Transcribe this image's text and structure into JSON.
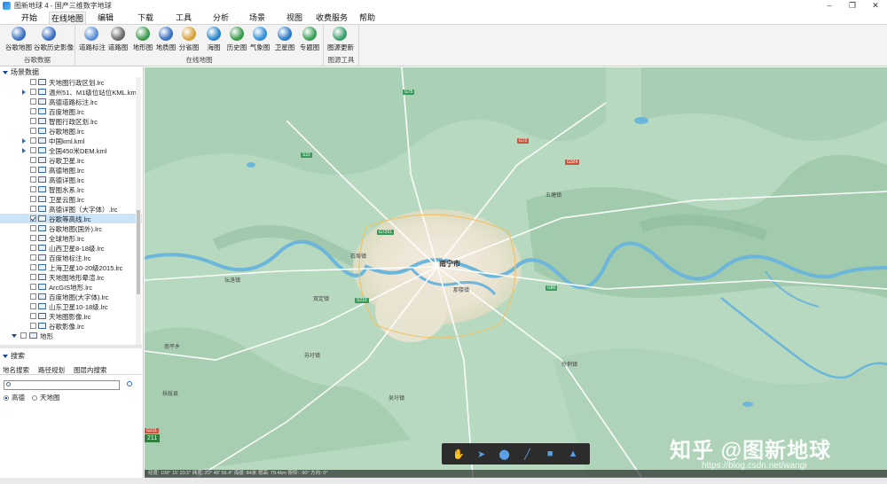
{
  "window": {
    "title": "图新地球 4 - 国产三维数字地球"
  },
  "menu": [
    {
      "label": "开始",
      "active": false
    },
    {
      "label": "在线地图",
      "active": true
    },
    {
      "label": "编辑",
      "active": false
    },
    {
      "label": "下载",
      "active": false
    },
    {
      "label": "工具",
      "active": false
    },
    {
      "label": "分析",
      "active": false
    },
    {
      "label": "场景",
      "active": false
    },
    {
      "label": "视图",
      "active": false
    },
    {
      "label": "收费服务",
      "active": false
    },
    {
      "label": "帮助",
      "active": false
    }
  ],
  "ribbon": {
    "groups": [
      {
        "label": "谷歌数据",
        "buttons": [
          {
            "label": "谷歌地图",
            "icon": "globe-icon",
            "color": "#3b6fc2"
          },
          {
            "label": "谷歌历史影像",
            "icon": "history-globe-icon",
            "color": "#3b6fc2"
          }
        ]
      },
      {
        "label": "在线地图",
        "buttons": [
          {
            "label": "道路标注",
            "icon": "road-label-icon",
            "color": "#5a8fd6"
          },
          {
            "label": "道路图",
            "icon": "road-map-icon",
            "color": "#6a6a6a"
          },
          {
            "label": "地形图",
            "icon": "terrain-icon",
            "color": "#3f9a52"
          },
          {
            "label": "地质图",
            "icon": "geology-icon",
            "color": "#3a72c0"
          },
          {
            "label": "分省图",
            "icon": "province-icon",
            "color": "#d8a23a"
          },
          {
            "label": "海图",
            "icon": "sea-chart-icon",
            "color": "#2a86c9"
          },
          {
            "label": "历史图",
            "icon": "history-map-icon",
            "color": "#3b9a4b"
          },
          {
            "label": "气象图",
            "icon": "weather-icon",
            "color": "#2f8fd8"
          },
          {
            "label": "卫星图",
            "icon": "satellite-icon",
            "color": "#2d7ac9"
          },
          {
            "label": "专题图",
            "icon": "thematic-icon",
            "color": "#3aa055"
          }
        ]
      },
      {
        "label": "图源工具",
        "buttons": [
          {
            "label": "图源更新",
            "icon": "source-update-icon",
            "color": "#3aa06a"
          }
        ]
      }
    ]
  },
  "panel": {
    "title": "场景数据",
    "layers": [
      {
        "label": "天地图行政区划.lrc",
        "checked": false,
        "expander": "none"
      },
      {
        "label": "温州51、M1级位站位KML.kml",
        "checked": false,
        "expander": "closed"
      },
      {
        "label": "高德道路标注.lrc",
        "checked": false,
        "expander": "none"
      },
      {
        "label": "百度地图.lrc",
        "checked": false,
        "expander": "none"
      },
      {
        "label": "智图行政区划.lrc",
        "checked": false,
        "expander": "none"
      },
      {
        "label": "谷歌地图.lrc",
        "checked": false,
        "expander": "none"
      },
      {
        "label": "中国kml.kml",
        "checked": false,
        "expander": "closed"
      },
      {
        "label": "全国450米DEM.kml",
        "checked": false,
        "expander": "closed"
      },
      {
        "label": "谷歌卫星.lrc",
        "checked": false,
        "expander": "none"
      },
      {
        "label": "高德地图.lrc",
        "checked": false,
        "expander": "none"
      },
      {
        "label": "高德详图.lrc",
        "checked": false,
        "expander": "none"
      },
      {
        "label": "智图水系.lrc",
        "checked": false,
        "expander": "none"
      },
      {
        "label": "卫星云图.lrc",
        "checked": false,
        "expander": "none"
      },
      {
        "label": "高德详图（大字体）.lrc",
        "checked": false,
        "expander": "none"
      },
      {
        "label": "谷歌等高线.lrc",
        "checked": true,
        "expander": "none",
        "selected": true
      },
      {
        "label": "谷歌地图(国外).lrc",
        "checked": false,
        "expander": "none"
      },
      {
        "label": "全球地形.lrc",
        "checked": false,
        "expander": "none"
      },
      {
        "label": "山西卫星8-18级.lrc",
        "checked": false,
        "expander": "none"
      },
      {
        "label": "百度地标注.lrc",
        "checked": false,
        "expander": "none"
      },
      {
        "label": "上海卫星10-20级2015.lrc",
        "checked": false,
        "expander": "none"
      },
      {
        "label": "天地图地形晕渲.lrc",
        "checked": false,
        "expander": "none"
      },
      {
        "label": "ArcGIS地形.lrc",
        "checked": false,
        "expander": "none"
      },
      {
        "label": "百度地图(大字体).lrc",
        "checked": false,
        "expander": "none"
      },
      {
        "label": "山东卫星10-18级.lrc",
        "checked": false,
        "expander": "none"
      },
      {
        "label": "天地图影像.lrc",
        "checked": false,
        "expander": "none"
      },
      {
        "label": "谷歌影像.lrc",
        "checked": false,
        "expander": "none"
      }
    ],
    "terrain_node": "地形"
  },
  "search": {
    "title": "搜索",
    "tabs": [
      "地名搜索",
      "路径规划",
      "图层内搜索"
    ],
    "input_value": "",
    "sources": [
      {
        "label": "高德",
        "selected": true
      },
      {
        "label": "天地图",
        "selected": false
      }
    ]
  },
  "map": {
    "city": "南宁市",
    "places": [
      "南平乡",
      "扶绥县",
      "五塘镇",
      "那楼镇",
      "伶俐镇",
      "双定镇",
      "吴圩镇",
      "苏圩镇",
      "坛洛镇",
      "石埠镇"
    ],
    "shields": [
      "G75",
      "G72",
      "S22",
      "G7201",
      "G324",
      "G80",
      "S210",
      "G211"
    ],
    "road_badge": "211",
    "watermark": "知乎 @图新地球",
    "blogmark": "https://blog.csdn.net/wangi",
    "status": "经度: 108° 15' 20.5\"  纬度: 22° 48' 56.4\"  海拔: 84米  视高: 79.4km  俯仰: -90°  方向: 0°"
  },
  "toolbar": [
    {
      "name": "pan-tool",
      "glyph": "✋"
    },
    {
      "name": "select-tool",
      "glyph": "➤"
    },
    {
      "name": "placemark-tool",
      "glyph": "⬤"
    },
    {
      "name": "line-tool",
      "glyph": "╱"
    },
    {
      "name": "polygon-tool",
      "glyph": "■"
    },
    {
      "name": "measure-tool",
      "glyph": "▲"
    }
  ]
}
